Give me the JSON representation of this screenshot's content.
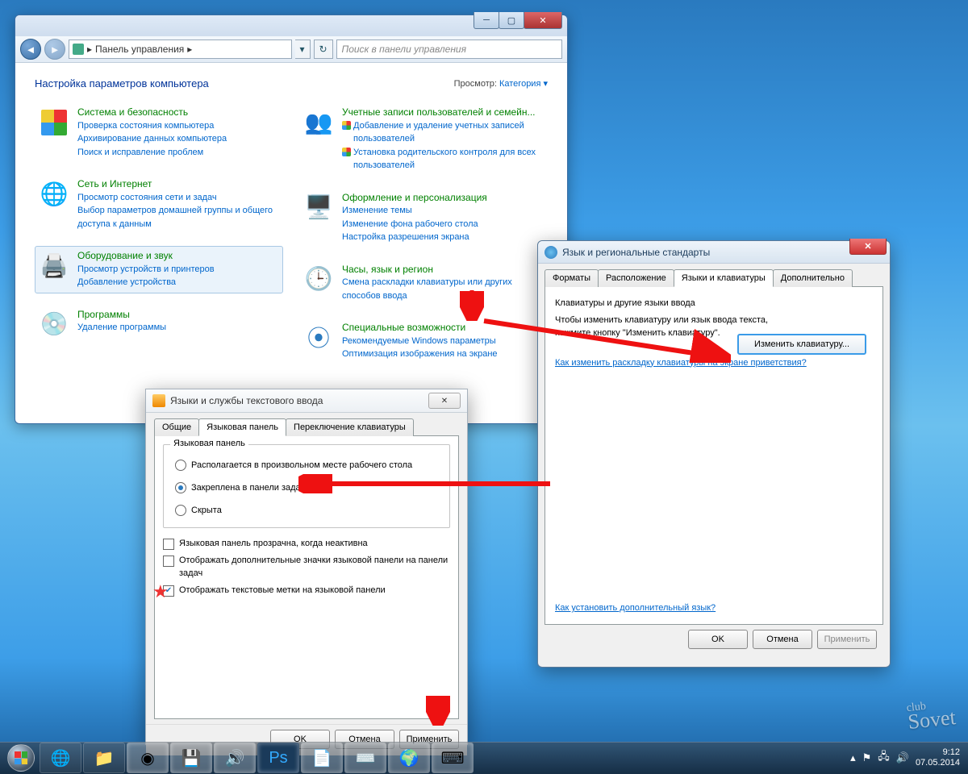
{
  "cp": {
    "breadcrumb": "Панель управления",
    "search_ph": "Поиск в панели управления",
    "heading": "Настройка параметров компьютера",
    "view_lbl": "Просмотр:",
    "view_val": "Категория ▾",
    "cats": {
      "sys": {
        "title": "Система и безопасность",
        "l1": "Проверка состояния компьютера",
        "l2": "Архивирование данных компьютера",
        "l3": "Поиск и исправление проблем"
      },
      "net": {
        "title": "Сеть и Интернет",
        "l1": "Просмотр состояния сети и задач",
        "l2": "Выбор параметров домашней группы и общего доступа к данным"
      },
      "hw": {
        "title": "Оборудование и звук",
        "l1": "Просмотр устройств и принтеров",
        "l2": "Добавление устройства"
      },
      "prog": {
        "title": "Программы",
        "l1": "Удаление программы"
      },
      "user": {
        "title": "Учетные записи пользователей и семейн...",
        "l1": "Добавление и удаление учетных записей пользователей",
        "l2": "Установка родительского контроля для всех пользователей"
      },
      "appr": {
        "title": "Оформление и персонализация",
        "l1": "Изменение темы",
        "l2": "Изменение фона рабочего стола",
        "l3": "Настройка разрешения экрана"
      },
      "clk": {
        "title": "Часы, язык и регион",
        "l1": "Смена раскладки клавиатуры или других способов ввода"
      },
      "ease": {
        "title": "Специальные возможности",
        "l1": "Рекомендуемые Windows параметры",
        "l2": "Оптимизация изображения на экране"
      }
    }
  },
  "rg": {
    "title": "Язык и региональные стандарты",
    "tabs": [
      "Форматы",
      "Расположение",
      "Языки и клавиатуры",
      "Дополнительно"
    ],
    "sub_hdr": "Клавиатуры и другие языки ввода",
    "sub_txt": "Чтобы изменить клавиатуру или язык ввода текста, нажмите кнопку \"Изменить клавиатуру\".",
    "btn": "Изменить клавиатуру...",
    "link1": "Как изменить раскладку клавиатуры на экране приветствия?",
    "link2": "Как установить дополнительный язык?",
    "ok": "OK",
    "cancel": "Отмена",
    "apply": "Применить"
  },
  "ts": {
    "title": "Языки и службы текстового ввода",
    "tabs": [
      "Общие",
      "Языковая панель",
      "Переключение клавиатуры"
    ],
    "grp": "Языковая панель",
    "r1": "Располагается в произвольном месте рабочего стола",
    "r2": "Закреплена в панели задач",
    "r3": "Скрыта",
    "c1": "Языковая панель прозрачна, когда неактивна",
    "c2": "Отображать дополнительные значки языковой панели на панели задач",
    "c3": "Отображать текстовые метки на языковой панели",
    "ok": "OK",
    "cancel": "Отмена",
    "apply": "Применить"
  },
  "tray": {
    "time": "9:12",
    "date": "07.05.2014"
  },
  "watermark": {
    "small": "club",
    "big": "Sovet"
  }
}
